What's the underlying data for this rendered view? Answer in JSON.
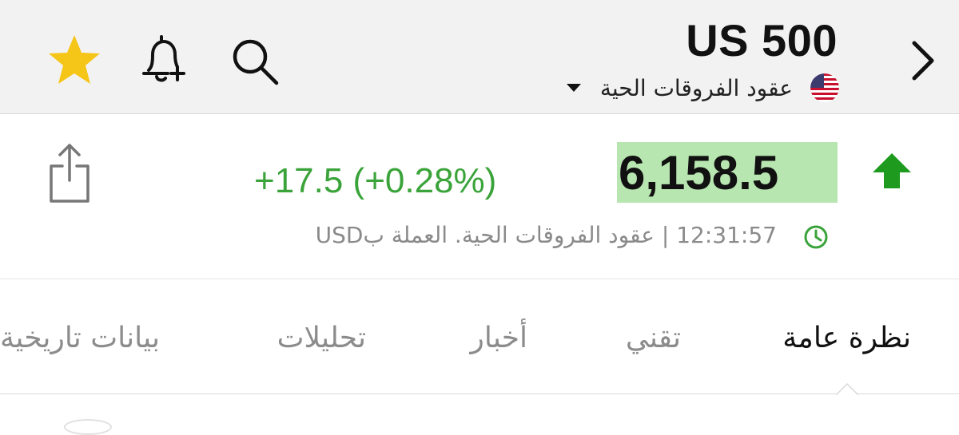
{
  "header": {
    "title": "US 500",
    "subtitle": "عقود الفروقات الحية",
    "icons": [
      "star-icon",
      "bell-plus-icon",
      "search-icon",
      "chevron-right-icon",
      "us-flag-icon",
      "caret-down-icon"
    ]
  },
  "quote": {
    "price": "6,158.5",
    "change": "+17.5 (+0.28%)",
    "meta": "12:31:57 | عقود الفروقات الحية. العملة بUSD",
    "colors": {
      "up": "#3aa33a",
      "price_highlight": "#b8e6b0",
      "star": "#f5c518",
      "arrow": "#1e9b1e"
    }
  },
  "tabs": [
    {
      "label": "نظرة عامة",
      "active": true
    },
    {
      "label": "تقني",
      "active": false
    },
    {
      "label": "أخبار",
      "active": false
    },
    {
      "label": "تحليلات",
      "active": false
    },
    {
      "label": "بيانات تاريخية",
      "active": false
    }
  ]
}
